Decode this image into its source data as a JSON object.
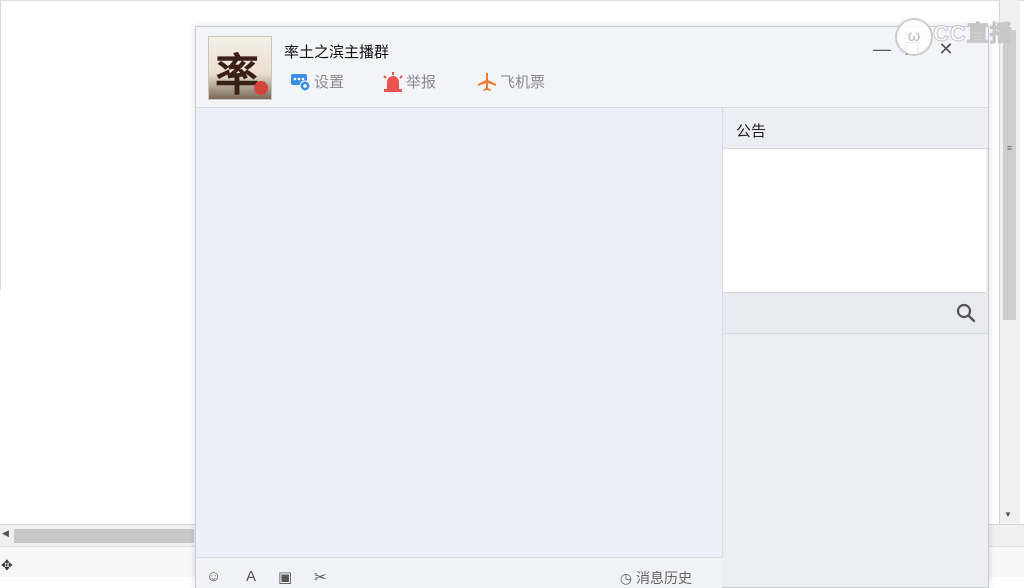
{
  "window": {
    "group_name": "率土之滨主播群",
    "avatar_glyph": "率",
    "toolbar": [
      {
        "label": "设置",
        "icon": "settings-chat-icon",
        "color": "#3a8ee6"
      },
      {
        "label": "举报",
        "icon": "alarm-icon",
        "color": "#e8554e"
      },
      {
        "label": "飞机票",
        "icon": "airplane-icon",
        "color": "#ef7a2b"
      }
    ],
    "controls": {
      "minimize": "—",
      "maximize": "☐",
      "close": "✕"
    }
  },
  "sidebar": {
    "notice_title": "公告",
    "notice_text": ""
  },
  "input_bar": {
    "history_label": "消息历史"
  },
  "watermark": {
    "text": "CC直播"
  }
}
